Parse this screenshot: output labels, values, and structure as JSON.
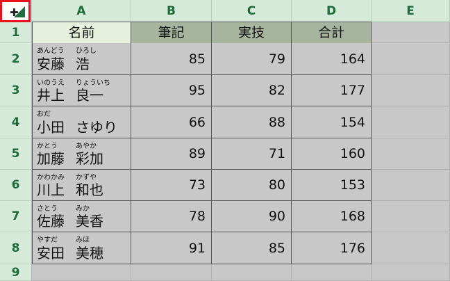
{
  "columns": [
    "A",
    "B",
    "C",
    "D",
    "E"
  ],
  "rows": [
    "1",
    "2",
    "3",
    "4",
    "5",
    "6",
    "7",
    "8",
    "9"
  ],
  "headers": [
    "名前",
    "筆記",
    "実技",
    "合計"
  ],
  "records": [
    {
      "surname_ruby": "あんどう",
      "given_ruby": "ひろし",
      "surname": "安藤",
      "given": "浩",
      "written": "85",
      "practical": "79",
      "total": "164"
    },
    {
      "surname_ruby": "いのうえ",
      "given_ruby": "りょういち",
      "surname": "井上",
      "given": "良一",
      "written": "95",
      "practical": "82",
      "total": "177"
    },
    {
      "surname_ruby": "おだ",
      "given_ruby": "",
      "surname": "小田",
      "given": "さゆり",
      "written": "66",
      "practical": "88",
      "total": "154"
    },
    {
      "surname_ruby": "かとう",
      "given_ruby": "あやか",
      "surname": "加藤",
      "given": "彩加",
      "written": "89",
      "practical": "71",
      "total": "160"
    },
    {
      "surname_ruby": "かわかみ",
      "given_ruby": "かずや",
      "surname": "川上",
      "given": "和也",
      "written": "73",
      "practical": "80",
      "total": "153"
    },
    {
      "surname_ruby": "さとう",
      "given_ruby": "みか",
      "surname": "佐藤",
      "given": "美香",
      "written": "78",
      "practical": "90",
      "total": "168"
    },
    {
      "surname_ruby": "やすだ",
      "given_ruby": "みほ",
      "surname": "安田",
      "given": "美穂",
      "written": "91",
      "practical": "85",
      "total": "176"
    }
  ],
  "colors": {
    "header_name_bg": "#e6f0dc",
    "header_score_bg": "#a7b59e",
    "cell_bg": "#c8c8c8",
    "heading_bg": "#d6ead9",
    "heading_text": "#1d6a3b",
    "select_all_border": "#e8121b"
  },
  "icons": {
    "corner_cross": "✚",
    "select_all": "select-all-triangle-icon"
  }
}
